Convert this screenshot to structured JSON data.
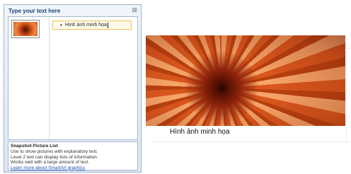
{
  "text_pane": {
    "title": "Type your text here",
    "close_glyph": "⊠",
    "items": [
      {
        "text": "Hình ảnh minh họa",
        "bullet": "•"
      }
    ],
    "description": {
      "title": "Snapshot Picture List",
      "text": "Use to show pictures with explanatory text. Level 2 text can display lists of information. Works well with a large amount of  text.",
      "link": "Learn more about SmartArt graphics"
    }
  },
  "graphic": {
    "caption": "Hình ảnh minh họa",
    "picture": "chrysanthemum-photo"
  }
}
